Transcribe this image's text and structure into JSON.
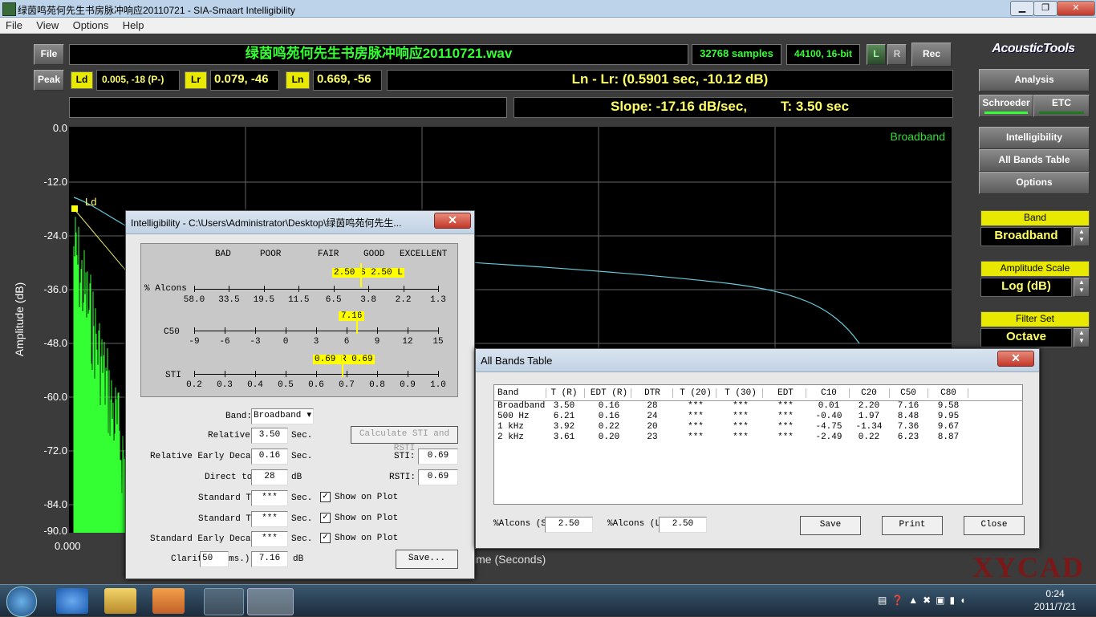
{
  "window": {
    "title": "绿茵鸣苑何先生书房脉冲响应20110721 - SIA-Smaart Intelligibility",
    "controls": [
      "▁",
      "❐",
      "✕"
    ]
  },
  "menu": [
    "File",
    "View",
    "Options",
    "Help"
  ],
  "toolbar": {
    "file_label": "File",
    "filename": "绿茵鸣苑何先生书房脉冲响应20110721.wav",
    "samples": "32768 samples",
    "format": "44100, 16-bit",
    "l_label": "L",
    "r_label": "R",
    "rec_label": "Rec",
    "peak_label": "Peak",
    "ld_label": "Ld",
    "ld_value": "0.005, -18 (P-)",
    "lr_label": "Lr",
    "lr_value": "0.079, -46",
    "ln_label": "Ln",
    "ln_value": "0.669, -56",
    "ln_lr_readout": "Ln - Lr: (0.5901 sec, -10.12 dB)",
    "slope": "Slope: -17.16 dB/sec,",
    "t_value": "T: 3.50 sec"
  },
  "brand": "AcousticTools",
  "side": {
    "analysis": "Analysis",
    "schroeder": "Schroeder",
    "etc": "ETC",
    "intelligibility": "Intelligibility",
    "all_bands_table": "All Bands Table",
    "options": "Options",
    "band_label": "Band",
    "band_value": "Broadband",
    "amp_label": "Amplitude Scale",
    "amp_value": "Log (dB)",
    "filter_label": "Filter Set",
    "filter_value": "Octave"
  },
  "plot": {
    "ylabel": "Amplitude (dB)",
    "yticks": [
      "0.0",
      "-12.0",
      "-24.0",
      "-36.0",
      "-48.0",
      "-60.0",
      "-72.0",
      "-84.0",
      "-90.0"
    ],
    "x0": "0.000",
    "xlabel_partial": "ime (Seconds)",
    "broadband_label": "Broadband",
    "ld_marker": "Ld"
  },
  "intel": {
    "title": "Intelligibility - C:\\Users\\Administrator\\Desktop\\绿茵鸣苑何先生...",
    "close": "✕",
    "ratings": [
      "BAD",
      "POOR",
      "FAIR",
      "GOOD",
      "EXCELLENT"
    ],
    "alcons_label": "% Alcons",
    "alcons_ticks": [
      "58.0",
      "33.5",
      "19.5",
      "11.5",
      "6.5",
      "3.8",
      "2.2",
      "1.3"
    ],
    "alcons_marker": "2.50 S 2.50 L",
    "c50_label": "C50",
    "c50_ticks": [
      "-9",
      "-6",
      "-3",
      "0",
      "3",
      "6",
      "9",
      "12",
      "15"
    ],
    "c50_marker": "7.16",
    "sti_label": "STI",
    "sti_ticks": [
      "0.2",
      "0.3",
      "0.4",
      "0.5",
      "0.6",
      "0.7",
      "0.8",
      "0.9",
      "1.0"
    ],
    "sti_marker": "0.69 R 0.69",
    "band_label": "Band:",
    "band_value": "Broadband",
    "relative_label": "Relative",
    "relative_value": "3.50",
    "sec": "Sec.",
    "calc_button": "Calculate STI and RSTI",
    "red_label": "Relative Early Decay",
    "red_value": "0.16",
    "sti_field_label": "STI:",
    "sti_field_value": "0.69",
    "direct_label": "Direct to",
    "direct_value": "28",
    "db": "dB",
    "rsti_label": "RSTI:",
    "rsti_value": "0.69",
    "std_t1_label": "Standard T",
    "std_t1_value": "***",
    "std_t2_label": "Standard T",
    "std_t2_value": "***",
    "sed_label": "Standard Early Decay",
    "sed_value": "***",
    "show_plot": "Show on Plot",
    "clarity_label": "Clarit",
    "clarity_ms_value": "50",
    "clarity_ms_label": "ms.)",
    "clarity_value": "7.16",
    "save": "Save..."
  },
  "allbands": {
    "title": "All Bands Table",
    "close": "✕",
    "headers": [
      "Band",
      "T (R)",
      "EDT (R)",
      "DTR",
      "T (20)",
      "T (30)",
      "EDT",
      "C10",
      "C20",
      "C50",
      "C80"
    ],
    "rows": [
      [
        "Broadband",
        "3.50",
        "0.16",
        "28",
        "***",
        "***",
        "***",
        "0.01",
        "2.20",
        "7.16",
        "9.58"
      ],
      [
        "500 Hz",
        "6.21",
        "0.16",
        "24",
        "***",
        "***",
        "***",
        "-0.40",
        "1.97",
        "8.48",
        "9.95"
      ],
      [
        "1 kHz",
        "3.92",
        "0.22",
        "20",
        "***",
        "***",
        "***",
        "-4.75",
        "-1.34",
        "7.36",
        "9.67"
      ],
      [
        "2 kHz",
        "3.61",
        "0.20",
        "23",
        "***",
        "***",
        "***",
        "-2.49",
        "0.22",
        "6.23",
        "8.87"
      ]
    ],
    "alcons_s_label": "%Alcons (S)",
    "alcons_s_value": "2.50",
    "alcons_l_label": "%Alcons (L)",
    "alcons_l_value": "2.50",
    "save": "Save",
    "print": "Print",
    "close_btn": "Close"
  },
  "taskbar": {
    "time": "0:24",
    "date": "2011/7/21"
  },
  "watermark": "XYCAD",
  "colors": {
    "lcd_green": "#33ff33",
    "lcd_yellow": "#ffff66",
    "trace_cyan": "#66ccdd",
    "impulse_green": "#33ff33",
    "yellow_button": "#e9e900"
  }
}
